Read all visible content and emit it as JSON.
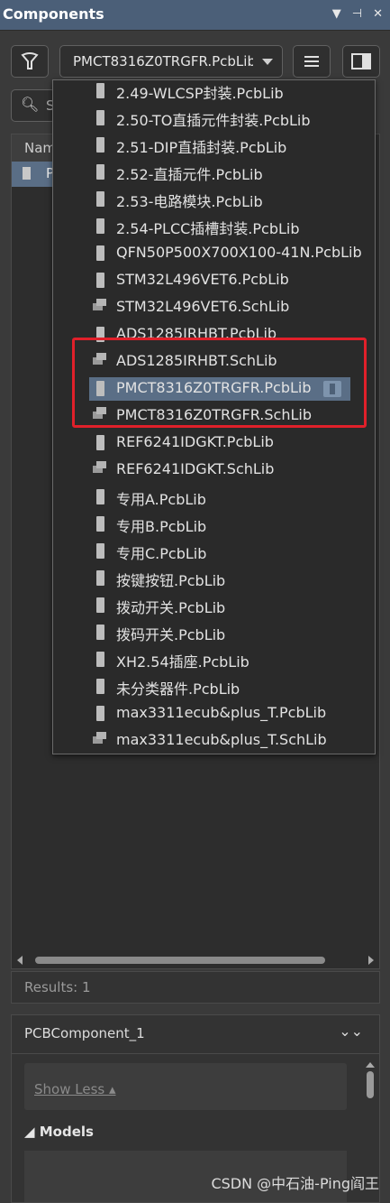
{
  "panel": {
    "title": "Components"
  },
  "toolbar": {
    "library_value": "PMCT8316Z0TRGFR.PcbLib"
  },
  "search": {
    "placeholder": "S"
  },
  "list": {
    "column_header": "Nam",
    "row_text": "P"
  },
  "dropdown": {
    "items": [
      {
        "label": "2.49-WLCSP封装.PcbLib",
        "kind": "pcb",
        "selected": false
      },
      {
        "label": "2.50-TO直插元件封装.PcbLib",
        "kind": "pcb",
        "selected": false
      },
      {
        "label": "2.51-DIP直插封装.PcbLib",
        "kind": "pcb",
        "selected": false
      },
      {
        "label": "2.52-直插元件.PcbLib",
        "kind": "pcb",
        "selected": false
      },
      {
        "label": "2.53-电路模块.PcbLib",
        "kind": "pcb",
        "selected": false
      },
      {
        "label": "2.54-PLCC插槽封装.PcbLib",
        "kind": "pcb",
        "selected": false
      },
      {
        "label": "QFN50P500X700X100-41N.PcbLib",
        "kind": "pcb",
        "selected": false
      },
      {
        "label": "STM32L496VET6.PcbLib",
        "kind": "pcb",
        "selected": false
      },
      {
        "label": "STM32L496VET6.SchLib",
        "kind": "sch",
        "selected": false
      },
      {
        "label": "ADS1285IRHBT.PcbLib",
        "kind": "pcb",
        "selected": false
      },
      {
        "label": "ADS1285IRHBT.SchLib",
        "kind": "sch",
        "selected": false
      },
      {
        "label": "PMCT8316Z0TRGFR.PcbLib",
        "kind": "pcb",
        "selected": true
      },
      {
        "label": "PMCT8316Z0TRGFR.SchLib",
        "kind": "sch",
        "selected": false
      },
      {
        "label": "REF6241IDGKT.PcbLib",
        "kind": "pcb",
        "selected": false
      },
      {
        "label": "REF6241IDGKT.SchLib",
        "kind": "sch",
        "selected": false
      },
      {
        "label": "专用A.PcbLib",
        "kind": "pcb",
        "selected": false
      },
      {
        "label": "专用B.PcbLib",
        "kind": "pcb",
        "selected": false
      },
      {
        "label": "专用C.PcbLib",
        "kind": "pcb",
        "selected": false
      },
      {
        "label": "按键按钮.PcbLib",
        "kind": "pcb",
        "selected": false
      },
      {
        "label": "拨动开关.PcbLib",
        "kind": "pcb",
        "selected": false
      },
      {
        "label": "拨码开关.PcbLib",
        "kind": "pcb",
        "selected": false
      },
      {
        "label": "XH2.54插座.PcbLib",
        "kind": "pcb",
        "selected": false
      },
      {
        "label": "未分类器件.PcbLib",
        "kind": "pcb",
        "selected": false
      },
      {
        "label": "max3311ecub&plus_T.PcbLib",
        "kind": "pcb",
        "selected": false
      },
      {
        "label": "max3311ecub&plus_T.SchLib",
        "kind": "sch",
        "selected": false
      }
    ]
  },
  "results": {
    "text": "Results: 1"
  },
  "detail": {
    "title": "PCBComponent_1",
    "show_less": "Show Less ▴",
    "models_label": "◢ Models"
  },
  "watermark": "CSDN @中石油-Ping阎王",
  "colors": {
    "title_bar": "#4b5f78",
    "selection": "#5a6e86",
    "highlight_box": "#e0202a"
  },
  "icons": [
    "filter-icon",
    "menu-icon",
    "panel-icon",
    "search-icon",
    "pin-icon",
    "dropdown-arrow-icon",
    "collapse-icon"
  ]
}
